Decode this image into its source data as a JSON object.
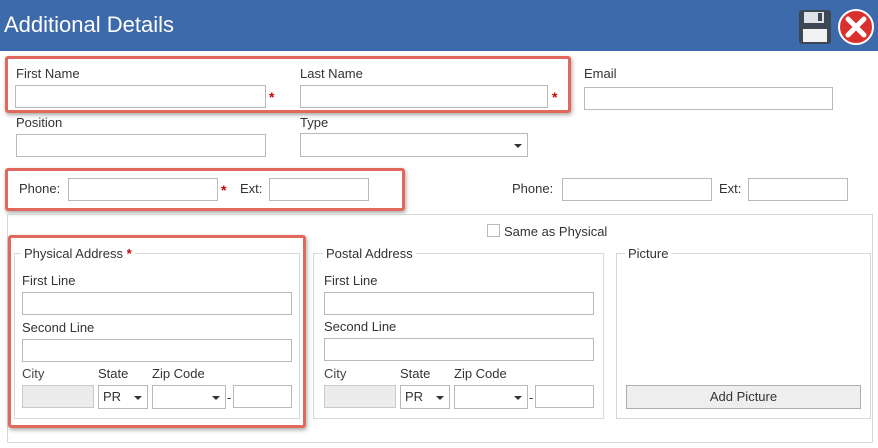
{
  "window": {
    "title": "Additional Details",
    "save_icon": "floppy-disk-icon",
    "close_icon": "red-x-circle-icon",
    "titlebar_color": "#3d6aaa",
    "highlight_color": "#e0685c",
    "required_color": "#d20000"
  },
  "contact": {
    "first_name_label": "First Name",
    "last_name_label": "Last Name",
    "email_label": "Email",
    "position_label": "Position",
    "type_label": "Type",
    "first_name_value": "",
    "last_name_value": "",
    "email_value": "",
    "position_value": "",
    "type_value": ""
  },
  "phones": {
    "phone_label": "Phone:",
    "ext_label": "Ext:",
    "phone2_label": "Phone:",
    "ext2_label": "Ext:",
    "phone_value": "",
    "ext_value": "",
    "phone2_value": "",
    "ext2_value": ""
  },
  "required_marker": "*",
  "same_as_physical": {
    "label": "Same as Physical",
    "checked": false
  },
  "physical_address": {
    "legend": "Physical Address",
    "first_line_label": "First Line",
    "second_line_label": "Second Line",
    "city_label": "City",
    "state_label": "State",
    "zip_label": "Zip Code",
    "state_value": "PR",
    "zip_separator": "-"
  },
  "postal_address": {
    "legend": "Postal Address",
    "first_line_label": "First Line",
    "second_line_label": "Second Line",
    "city_label": "City",
    "state_label": "State",
    "zip_label": "Zip Code",
    "state_value": "PR",
    "zip_separator": "-"
  },
  "picture": {
    "legend": "Picture",
    "add_button_label": "Add Picture"
  }
}
